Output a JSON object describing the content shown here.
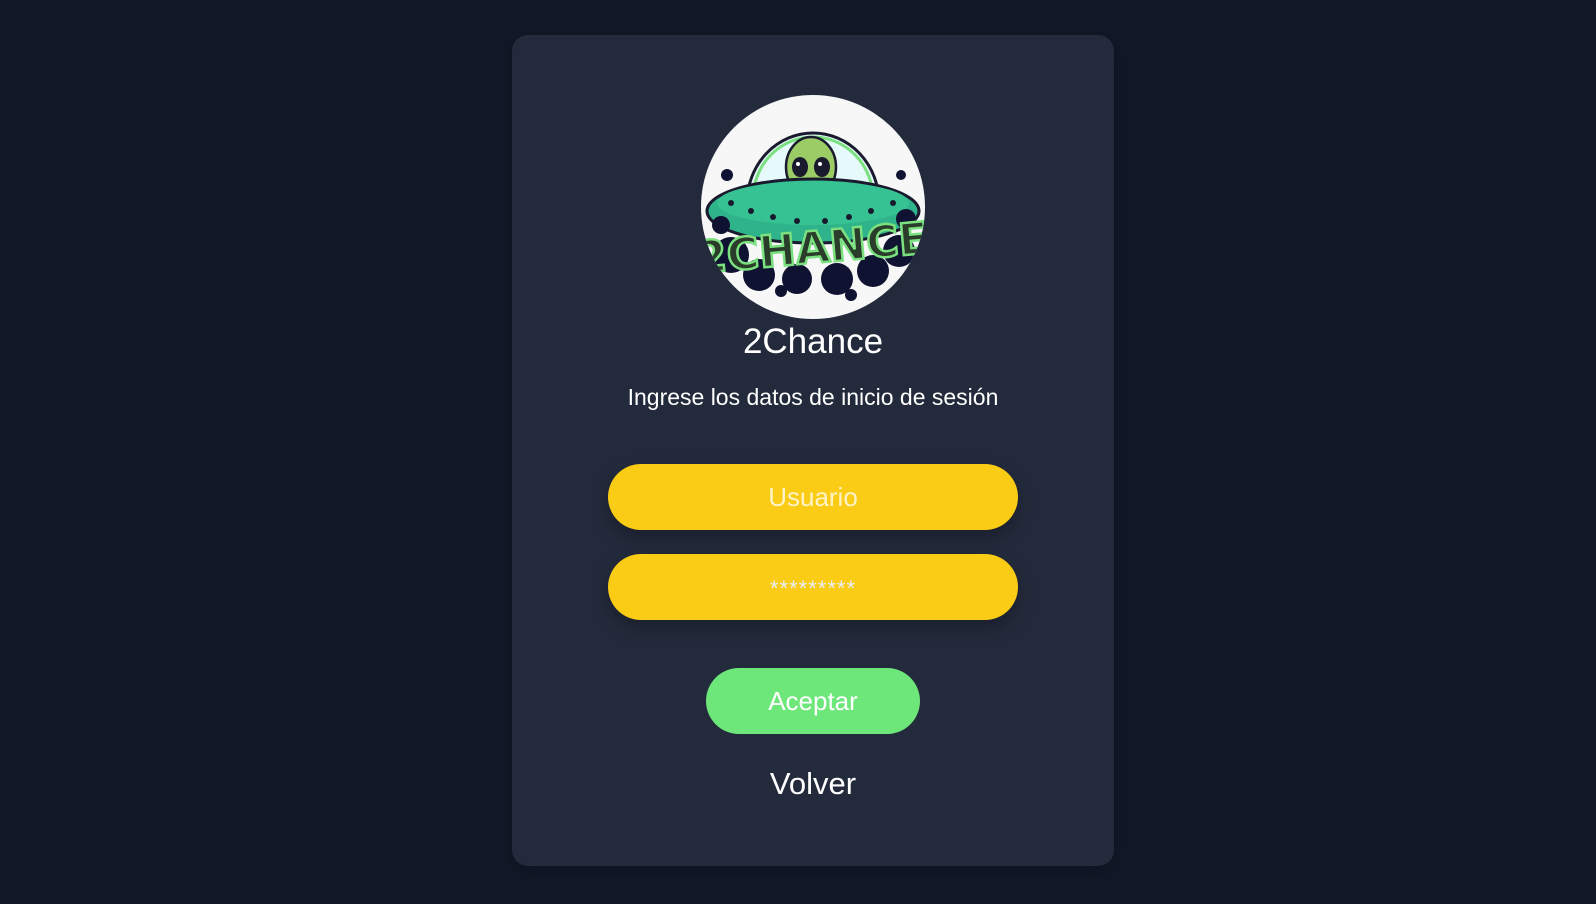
{
  "brand": {
    "logo_icon": "alien-ufo-logo-icon",
    "logo_text": "2CHANCE",
    "name": "2Chance"
  },
  "login": {
    "subtitle": "Ingrese los datos de inicio de sesión",
    "username_placeholder": "Usuario",
    "username_value": "",
    "password_placeholder": "*********",
    "password_value": "",
    "accept_label": "Aceptar",
    "back_label": "Volver"
  },
  "colors": {
    "background": "#111827",
    "card": "#232a3b",
    "input": "#facc15",
    "accept_button": "#6ee77a",
    "text": "#ffffff"
  }
}
